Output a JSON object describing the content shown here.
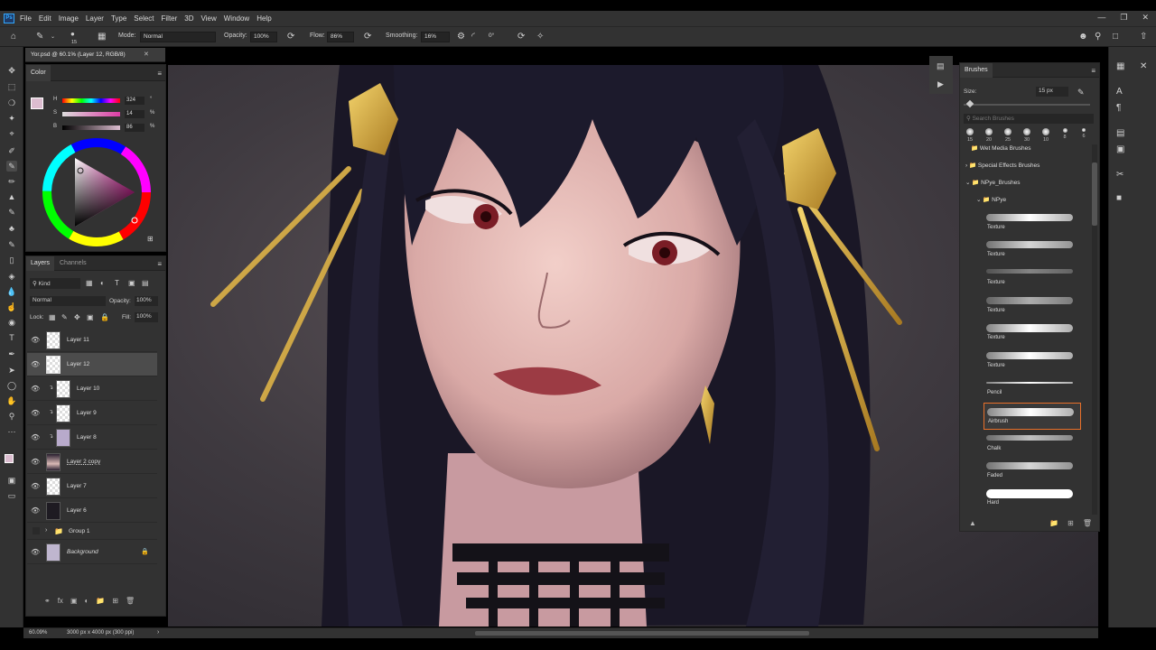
{
  "app": {
    "logo": "Ps",
    "menu": [
      "File",
      "Edit",
      "Image",
      "Layer",
      "Type",
      "Select",
      "Filter",
      "3D",
      "View",
      "Window",
      "Help"
    ],
    "window_controls": [
      "minimize-icon",
      "restore-icon",
      "close-icon"
    ]
  },
  "options": {
    "brush_size": "15",
    "mode_label": "Mode:",
    "mode_value": "Normal",
    "opacity_label": "Opacity:",
    "opacity_value": "100%",
    "flow_label": "Flow:",
    "flow_value": "86%",
    "smoothing_label": "Smoothing:",
    "smoothing_value": "16%",
    "angle_value": "0°"
  },
  "document": {
    "tab_title": "Yor.psd @ 60.1% (Layer 12, RGB/8)"
  },
  "color_panel": {
    "title": "Color",
    "h_label": "H",
    "h_value": "324",
    "h_unit": "°",
    "s_label": "S",
    "s_value": "14",
    "s_unit": "%",
    "b_label": "B",
    "b_value": "86",
    "b_unit": "%",
    "foreground": "#dcbdd0"
  },
  "layers_panel": {
    "tab_layers": "Layers",
    "tab_channels": "Channels",
    "filter_kind": "Kind",
    "blend_mode": "Normal",
    "opacity_label": "Opacity:",
    "opacity_value": "100%",
    "lock_label": "Lock:",
    "fill_label": "Fill:",
    "fill_value": "100%",
    "layers": [
      {
        "name": "Layer 11"
      },
      {
        "name": "Layer 12"
      },
      {
        "name": "Layer 10"
      },
      {
        "name": "Layer 9"
      },
      {
        "name": "Layer 8"
      },
      {
        "name": "Layer 2 copy"
      },
      {
        "name": "Layer 7"
      },
      {
        "name": "Layer 6"
      },
      {
        "name": "Group 1"
      },
      {
        "name": "Background"
      }
    ]
  },
  "status": {
    "zoom": "60.09%",
    "doc_size": "3000 px x 4000 px (300 ppi)"
  },
  "brushes_panel": {
    "title": "Brushes",
    "size_label": "Size:",
    "size_value": "15 px",
    "search_placeholder": "Search Brushes",
    "presets": [
      "15",
      "20",
      "25",
      "30",
      "10",
      "8",
      "6"
    ],
    "folders": [
      "Wet Media Brushes",
      "Special Effects Brushes",
      "NPye_Brushes",
      "NPye"
    ],
    "brushes": [
      "Texture",
      "Texture",
      "Texture",
      "Texture",
      "Texture",
      "Texture",
      "Pencil",
      "Airbrush",
      "Chalk",
      "Faded",
      "Hard"
    ],
    "selected_brush": "Airbrush"
  }
}
